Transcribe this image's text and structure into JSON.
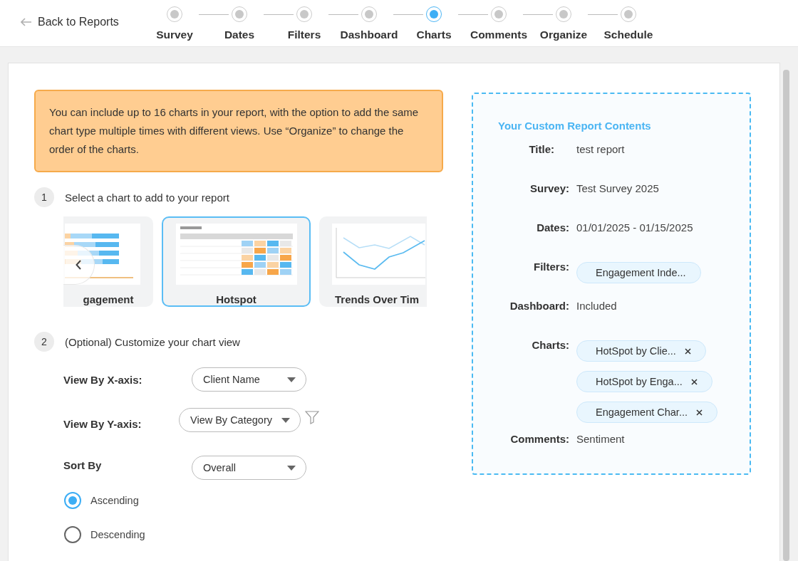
{
  "header": {
    "back_link": "Back to Reports"
  },
  "steps": [
    {
      "label": "Survey",
      "selected": false
    },
    {
      "label": "Dates",
      "selected": false
    },
    {
      "label": "Filters",
      "selected": false
    },
    {
      "label": "Dashboard",
      "selected": false
    },
    {
      "label": "Charts",
      "selected": true
    },
    {
      "label": "Comments",
      "selected": false
    },
    {
      "label": "Organize",
      "selected": false
    },
    {
      "label": "Schedule",
      "selected": false
    }
  ],
  "notice": "You can include up to 16 charts in your report, with the option to add the same chart type multiple times with different views. Use “Organize” to change the order of the charts.",
  "step_1": {
    "number": "1",
    "title": "Select a chart to add to your report"
  },
  "chart_cards": [
    {
      "label": "gagement",
      "kind": "bars",
      "selected": false
    },
    {
      "label": "Hotspot",
      "kind": "table",
      "selected": true
    },
    {
      "label": "Trends Over Tim",
      "kind": "lines",
      "selected": false
    }
  ],
  "step_2": {
    "number": "2",
    "title": "(Optional) Customize your chart view"
  },
  "x_axis": {
    "label": "View By X-axis:",
    "value": "Client Name"
  },
  "y_axis": {
    "label": "View By Y-axis:",
    "value": "View By Category"
  },
  "sort": {
    "label": "Sort By",
    "value": "Overall"
  },
  "order_options": [
    {
      "label": "Ascending",
      "selected": true
    },
    {
      "label": "Descending",
      "selected": false
    }
  ],
  "summary": {
    "heading": "Your Custom Report Contents",
    "rows": [
      {
        "label": "Title:",
        "kind": "text",
        "value": "test report"
      },
      {
        "label": "Survey:",
        "kind": "text",
        "value": "Test Survey 2025"
      },
      {
        "label": "Dates:",
        "kind": "text",
        "value": "01/01/2025 - 01/15/2025"
      },
      {
        "label": "Filters:",
        "kind": "chips",
        "chips": [
          {
            "text": "Engagement Inde...",
            "removable": false
          }
        ]
      },
      {
        "label": "Dashboard:",
        "kind": "text",
        "value": "Included"
      },
      {
        "label": "Charts:",
        "kind": "chips",
        "chips": [
          {
            "text": "HotSpot by Clie...",
            "removable": true
          },
          {
            "text": "HotSpot by Enga...",
            "removable": true
          },
          {
            "text": "Engagement Char...",
            "removable": true
          }
        ]
      },
      {
        "label": "Comments:",
        "kind": "text",
        "value": "Sentiment"
      }
    ]
  }
}
